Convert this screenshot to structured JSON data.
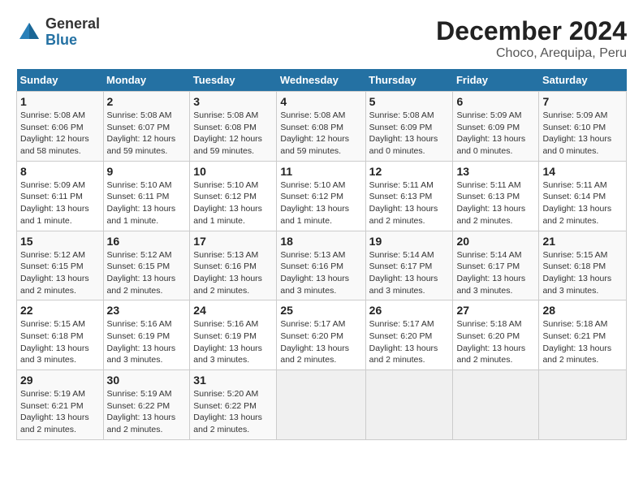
{
  "header": {
    "logo_general": "General",
    "logo_blue": "Blue",
    "title": "December 2024",
    "subtitle": "Choco, Arequipa, Peru"
  },
  "weekdays": [
    "Sunday",
    "Monday",
    "Tuesday",
    "Wednesday",
    "Thursday",
    "Friday",
    "Saturday"
  ],
  "weeks": [
    [
      {
        "day": "1",
        "sunrise": "5:08 AM",
        "sunset": "6:06 PM",
        "daylight": "12 hours and 58 minutes."
      },
      {
        "day": "2",
        "sunrise": "5:08 AM",
        "sunset": "6:07 PM",
        "daylight": "12 hours and 59 minutes."
      },
      {
        "day": "3",
        "sunrise": "5:08 AM",
        "sunset": "6:08 PM",
        "daylight": "12 hours and 59 minutes."
      },
      {
        "day": "4",
        "sunrise": "5:08 AM",
        "sunset": "6:08 PM",
        "daylight": "12 hours and 59 minutes."
      },
      {
        "day": "5",
        "sunrise": "5:08 AM",
        "sunset": "6:09 PM",
        "daylight": "13 hours and 0 minutes."
      },
      {
        "day": "6",
        "sunrise": "5:09 AM",
        "sunset": "6:09 PM",
        "daylight": "13 hours and 0 minutes."
      },
      {
        "day": "7",
        "sunrise": "5:09 AM",
        "sunset": "6:10 PM",
        "daylight": "13 hours and 0 minutes."
      }
    ],
    [
      {
        "day": "8",
        "sunrise": "5:09 AM",
        "sunset": "6:11 PM",
        "daylight": "13 hours and 1 minute."
      },
      {
        "day": "9",
        "sunrise": "5:10 AM",
        "sunset": "6:11 PM",
        "daylight": "13 hours and 1 minute."
      },
      {
        "day": "10",
        "sunrise": "5:10 AM",
        "sunset": "6:12 PM",
        "daylight": "13 hours and 1 minute."
      },
      {
        "day": "11",
        "sunrise": "5:10 AM",
        "sunset": "6:12 PM",
        "daylight": "13 hours and 1 minute."
      },
      {
        "day": "12",
        "sunrise": "5:11 AM",
        "sunset": "6:13 PM",
        "daylight": "13 hours and 2 minutes."
      },
      {
        "day": "13",
        "sunrise": "5:11 AM",
        "sunset": "6:13 PM",
        "daylight": "13 hours and 2 minutes."
      },
      {
        "day": "14",
        "sunrise": "5:11 AM",
        "sunset": "6:14 PM",
        "daylight": "13 hours and 2 minutes."
      }
    ],
    [
      {
        "day": "15",
        "sunrise": "5:12 AM",
        "sunset": "6:15 PM",
        "daylight": "13 hours and 2 minutes."
      },
      {
        "day": "16",
        "sunrise": "5:12 AM",
        "sunset": "6:15 PM",
        "daylight": "13 hours and 2 minutes."
      },
      {
        "day": "17",
        "sunrise": "5:13 AM",
        "sunset": "6:16 PM",
        "daylight": "13 hours and 2 minutes."
      },
      {
        "day": "18",
        "sunrise": "5:13 AM",
        "sunset": "6:16 PM",
        "daylight": "13 hours and 3 minutes."
      },
      {
        "day": "19",
        "sunrise": "5:14 AM",
        "sunset": "6:17 PM",
        "daylight": "13 hours and 3 minutes."
      },
      {
        "day": "20",
        "sunrise": "5:14 AM",
        "sunset": "6:17 PM",
        "daylight": "13 hours and 3 minutes."
      },
      {
        "day": "21",
        "sunrise": "5:15 AM",
        "sunset": "6:18 PM",
        "daylight": "13 hours and 3 minutes."
      }
    ],
    [
      {
        "day": "22",
        "sunrise": "5:15 AM",
        "sunset": "6:18 PM",
        "daylight": "13 hours and 3 minutes."
      },
      {
        "day": "23",
        "sunrise": "5:16 AM",
        "sunset": "6:19 PM",
        "daylight": "13 hours and 3 minutes."
      },
      {
        "day": "24",
        "sunrise": "5:16 AM",
        "sunset": "6:19 PM",
        "daylight": "13 hours and 3 minutes."
      },
      {
        "day": "25",
        "sunrise": "5:17 AM",
        "sunset": "6:20 PM",
        "daylight": "13 hours and 2 minutes."
      },
      {
        "day": "26",
        "sunrise": "5:17 AM",
        "sunset": "6:20 PM",
        "daylight": "13 hours and 2 minutes."
      },
      {
        "day": "27",
        "sunrise": "5:18 AM",
        "sunset": "6:20 PM",
        "daylight": "13 hours and 2 minutes."
      },
      {
        "day": "28",
        "sunrise": "5:18 AM",
        "sunset": "6:21 PM",
        "daylight": "13 hours and 2 minutes."
      }
    ],
    [
      {
        "day": "29",
        "sunrise": "5:19 AM",
        "sunset": "6:21 PM",
        "daylight": "13 hours and 2 minutes."
      },
      {
        "day": "30",
        "sunrise": "5:19 AM",
        "sunset": "6:22 PM",
        "daylight": "13 hours and 2 minutes."
      },
      {
        "day": "31",
        "sunrise": "5:20 AM",
        "sunset": "6:22 PM",
        "daylight": "13 hours and 2 minutes."
      },
      null,
      null,
      null,
      null
    ]
  ]
}
